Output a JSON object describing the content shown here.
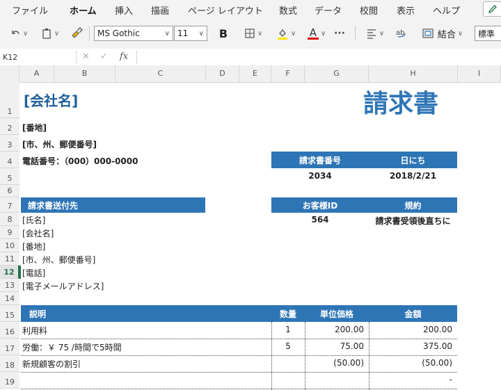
{
  "menu": {
    "tabs": [
      "ファイル",
      "ホーム",
      "挿入",
      "描画",
      "ページ レイアウト",
      "数式",
      "データ",
      "校閲",
      "表示",
      "ヘルプ"
    ]
  },
  "ribbon": {
    "font_name": "MS Gothic",
    "font_size": "11",
    "bold_label": "B",
    "font_color_label": "A",
    "more_label": "···",
    "merge_label": "結合",
    "number_format": "標準"
  },
  "formula_bar": {
    "name_box": "K12",
    "fx_label": "fx",
    "value": ""
  },
  "columns": [
    "A",
    "B",
    "C",
    "D",
    "E",
    "F",
    "G",
    "H",
    "I"
  ],
  "rows": [
    "1",
    "2",
    "3",
    "4",
    "5",
    "6",
    "7",
    "8",
    "9",
    "10",
    "11",
    "12",
    "13",
    "14",
    "15",
    "16",
    "17",
    "18",
    "19"
  ],
  "header": {
    "company": "[会社名]",
    "title": "請求書",
    "address": "[番地]",
    "city": "[市、州、郵便番号]",
    "phone": "電話番号：（000）000-0000"
  },
  "invoice_meta": {
    "invoice_no_label": "請求書番号",
    "date_label": "日にち",
    "invoice_no": "2034",
    "date": "2018/2/21",
    "customer_id_label": "お客様ID",
    "terms_label": "規約",
    "customer_id": "564",
    "terms": "請求書受領後直ちに"
  },
  "bill_to": {
    "label": "請求書送付先",
    "name": "[氏名]",
    "company": "[会社名]",
    "address": "[番地]",
    "city": "[市、州、郵便番号]",
    "phone": "[電話]",
    "email": "[電子メールアドレス]"
  },
  "table": {
    "headers": {
      "description": "説明",
      "qty": "数量",
      "unit_price": "単位価格",
      "amount": "金額"
    },
    "rows": [
      {
        "description": "利用料",
        "qty": "1",
        "unit_price": "200.00",
        "amount": "200.00"
      },
      {
        "description": "労働：￥ 75 /時間で5時間",
        "qty": "5",
        "unit_price": "75.00",
        "amount": "375.00"
      },
      {
        "description": "新規顧客の割引",
        "qty": "",
        "unit_price": "(50.00)",
        "amount": "(50.00)"
      },
      {
        "description": "",
        "qty": "",
        "unit_price": "",
        "amount": "-"
      }
    ]
  },
  "colors": {
    "accent": "#2e75b6",
    "excel_green": "#1e7145"
  }
}
